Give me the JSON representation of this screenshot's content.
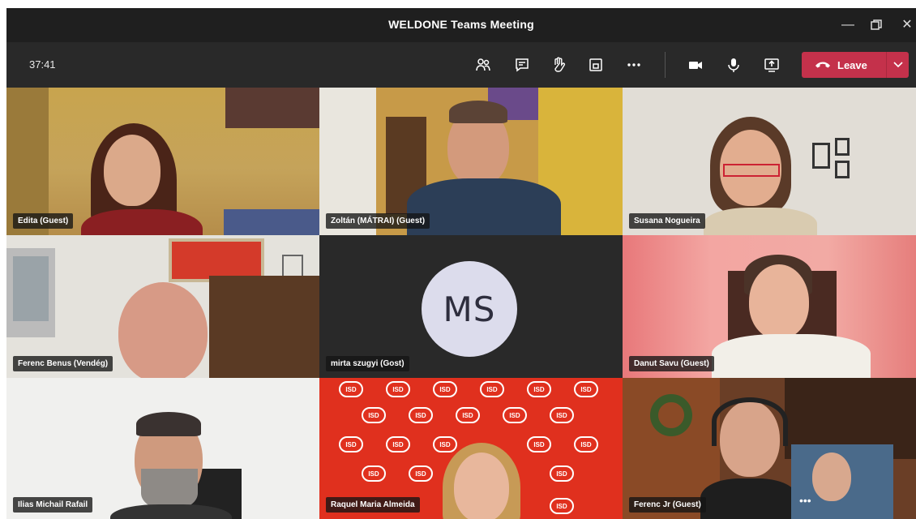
{
  "window": {
    "title": "WELDONE Teams Meeting",
    "controls": [
      "minimize-icon",
      "restore-icon",
      "close-icon"
    ]
  },
  "toolbar": {
    "timer": "37:41",
    "buttons": [
      "participants-icon",
      "chat-icon",
      "raise-hand-icon",
      "rooms-icon",
      "more-icon",
      "camera-icon",
      "microphone-icon",
      "share-screen-icon"
    ],
    "leave_label": "Leave",
    "leave_color": "#c4314b"
  },
  "participants": [
    {
      "name": "Edita (Guest)"
    },
    {
      "name": "Zoltán (MÁTRAI) (Guest)"
    },
    {
      "name": "Susana Nogueira"
    },
    {
      "name": "Ferenc Benus (Vendég)"
    },
    {
      "name": "mirta szugyi (Gost)",
      "initials": "MS"
    },
    {
      "name": "Danut Savu (Guest)"
    },
    {
      "name": "Ilias Michail Rafail"
    },
    {
      "name": "Raquel Maria Almeida",
      "background_logo": "ISD"
    },
    {
      "name": "Ferenc Jr (Guest)"
    }
  ]
}
